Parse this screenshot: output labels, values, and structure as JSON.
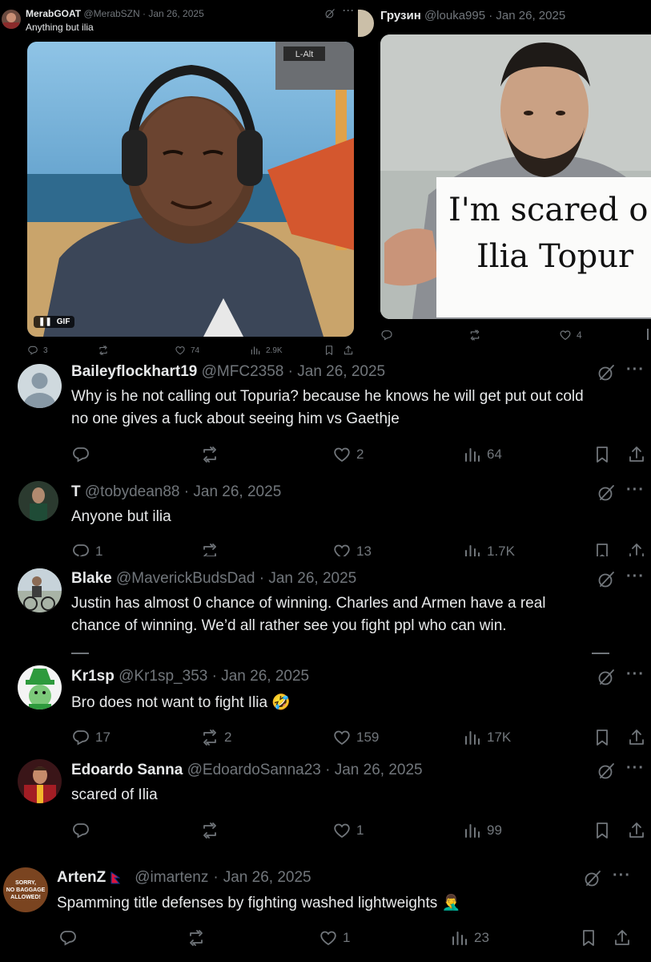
{
  "top_left": {
    "name": "MerabGOAT",
    "handle": "@MerabSZN",
    "date": "Jan 26, 2025",
    "text": "Anything but ilia",
    "gif_badge": "GIF",
    "gif_overlay": "L-Alt",
    "replies": "3",
    "likes": "74",
    "views": "2.9K"
  },
  "top_right": {
    "name": "Грузин",
    "handle": "@louka995",
    "date": "Jan 26, 2025",
    "sign_line1": "I'm scared o",
    "sign_line2": "Ilia Topur",
    "likes": "4"
  },
  "replies": [
    {
      "name": "Baileyflockhart19",
      "handle": "@MFC2358",
      "date": "Jan 26, 2025",
      "text_line1": "Why is he not calling out Topuria? because he knows he will get put out cold",
      "text_line2": "no one gives a fuck about seeing him vs Gaethje",
      "replies": "",
      "retweets": "",
      "likes": "2",
      "views": "64"
    },
    {
      "name": "T",
      "handle": "@tobydean88",
      "date": "Jan 26, 2025",
      "text": "Anyone but ilia",
      "replies": "1",
      "likes": "13",
      "views": "1.7K"
    },
    {
      "name": "Blake",
      "handle": "@MaverickBudsDad",
      "date": "Jan 26, 2025",
      "text_line1": "Justin has almost 0 chance of winning. Charles and Armen have a real",
      "text_line2": "chance of winning. We’d all rather see you fight ppl who can win."
    },
    {
      "name": "Kr1sp",
      "handle": "@Kr1sp_353",
      "date": "Jan 26, 2025",
      "text": "Bro does not want to fight Ilia",
      "emoji": "🤣",
      "replies": "17",
      "retweets": "2",
      "likes": "159",
      "views": "17K"
    },
    {
      "name": "Edoardo Sanna",
      "handle": "@EdoardoSanna23",
      "date": "Jan 26, 2025",
      "text": "scared of Ilia",
      "likes": "1",
      "views": "99"
    },
    {
      "name": "ArtenZ",
      "handle": "@imartenz",
      "date": "Jan 26, 2025",
      "text": "Spamming title defenses by fighting washed lightweights",
      "emoji": "🤦‍♂️",
      "avatar_text1": "SORRY,",
      "avatar_text2": "NO BAGGAGE",
      "avatar_text3": "ALLOWED!",
      "likes": "1",
      "views": "23"
    }
  ],
  "icons": [
    "reply-icon",
    "retweet-icon",
    "like-icon",
    "views-icon",
    "bookmark-icon",
    "share-icon",
    "grok-icon",
    "more-icon"
  ],
  "colors": {
    "bg": "#000000",
    "text": "#e7e9ea",
    "muted": "#71767b"
  }
}
